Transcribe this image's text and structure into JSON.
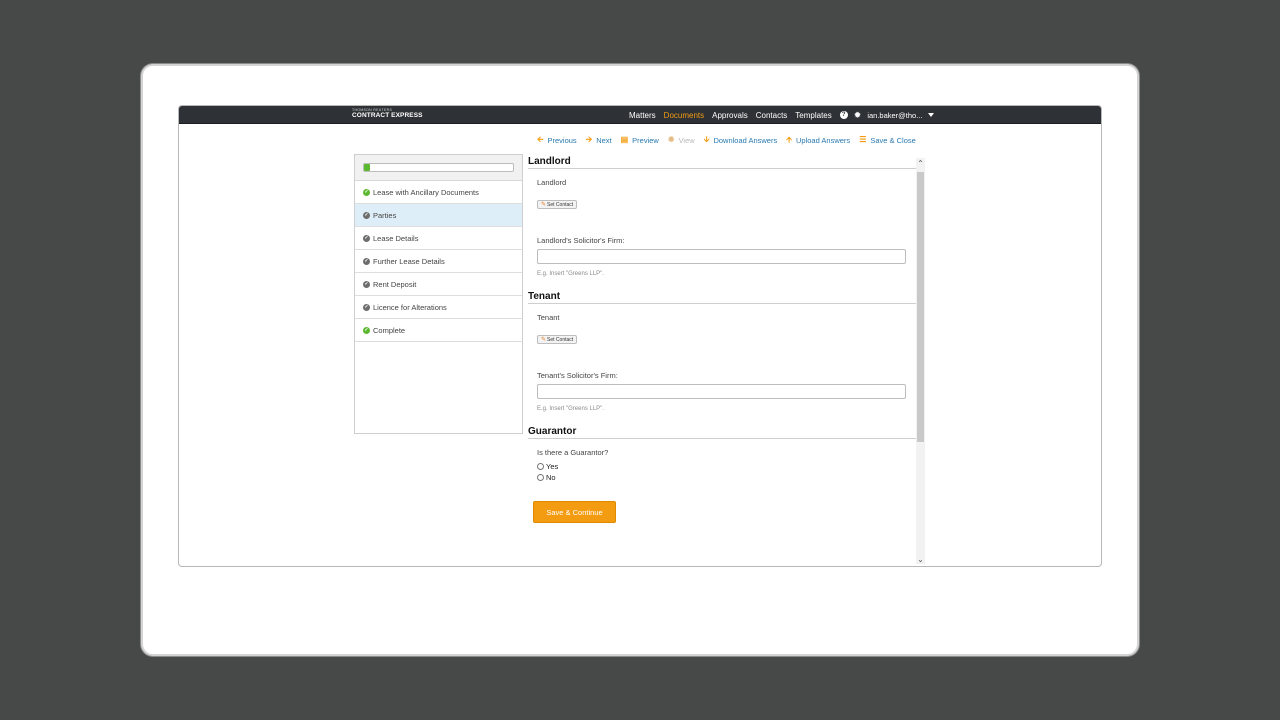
{
  "brand": {
    "small": "THOMSON REUTERS",
    "name": "CONTRACT EXPRESS"
  },
  "nav": {
    "items": [
      {
        "label": "Matters"
      },
      {
        "label": "Documents"
      },
      {
        "label": "Approvals"
      },
      {
        "label": "Contacts"
      },
      {
        "label": "Templates"
      }
    ],
    "active": "Documents",
    "help_glyph": "?",
    "user": "ian.baker@tho..."
  },
  "toolbar": {
    "previous": "Previous",
    "next": "Next",
    "preview": "Preview",
    "view": "View",
    "download": "Download Answers",
    "upload": "Upload Answers",
    "save_close": "Save & Close"
  },
  "sidebar": {
    "progress_fraction": 0.04,
    "steps": [
      {
        "label": "Lease with Ancillary Documents",
        "status": "done"
      },
      {
        "label": "Parties",
        "status": "pending",
        "active": true
      },
      {
        "label": "Lease Details",
        "status": "pending"
      },
      {
        "label": "Further Lease Details",
        "status": "pending"
      },
      {
        "label": "Rent Deposit",
        "status": "pending"
      },
      {
        "label": "Licence for Alterations",
        "status": "pending"
      },
      {
        "label": "Complete",
        "status": "done"
      }
    ]
  },
  "form": {
    "landlord": {
      "title": "Landlord",
      "label": "Landlord",
      "set_contact": "Set Contact",
      "firm_label": "Landlord's Solicitor's Firm:",
      "firm_value": "",
      "firm_hint": "E.g. Insert \"Greens LLP\"."
    },
    "tenant": {
      "title": "Tenant",
      "label": "Tenant",
      "set_contact": "Set Contact",
      "firm_label": "Tenant's Solicitor's Firm:",
      "firm_value": "",
      "firm_hint": "E.g. Insert \"Greens LLP\"."
    },
    "guarantor": {
      "title": "Guarantor",
      "question": "Is there a Guarantor?",
      "options": [
        "Yes",
        "No"
      ]
    },
    "save_continue": "Save & Continue"
  },
  "colors": {
    "accent": "#f39c12",
    "link": "#2a7ab0",
    "success": "#5cb82e",
    "topbar": "#2e3135"
  }
}
